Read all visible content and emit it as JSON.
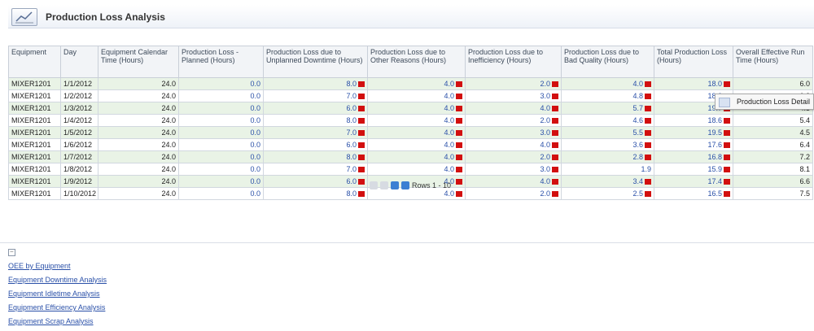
{
  "header": {
    "title": "Production Loss Analysis",
    "icon": "chart-report-icon"
  },
  "table": {
    "columns": [
      "Equipment",
      "Day",
      "Equipment Calendar Time (Hours)",
      "Production Loss - Planned (Hours)",
      "Production Loss due to Unplanned Downtime (Hours)",
      "Production Loss due to Other Reasons (Hours)",
      "Production Loss due to Inefficiency (Hours)",
      "Production Loss due to Bad Quality (Hours)",
      "Total Production Loss (Hours)",
      "Overall Effective Run Time (Hours)"
    ],
    "rows": [
      [
        "MIXER1201",
        "1/1/2012",
        "24.0",
        "0.0",
        "8.0",
        "4.0",
        "2.0",
        "4.0",
        "18.0",
        "6.0"
      ],
      [
        "MIXER1201",
        "1/2/2012",
        "24.0",
        "0.0",
        "7.0",
        "4.0",
        "3.0",
        "4.8",
        "18.0",
        "6.2"
      ],
      [
        "MIXER1201",
        "1/3/2012",
        "24.0",
        "0.0",
        "6.0",
        "4.0",
        "4.0",
        "5.7",
        "19.7",
        "4.3"
      ],
      [
        "MIXER1201",
        "1/4/2012",
        "24.0",
        "0.0",
        "8.0",
        "4.0",
        "2.0",
        "4.6",
        "18.6",
        "5.4"
      ],
      [
        "MIXER1201",
        "1/5/2012",
        "24.0",
        "0.0",
        "7.0",
        "4.0",
        "3.0",
        "5.5",
        "19.5",
        "4.5"
      ],
      [
        "MIXER1201",
        "1/6/2012",
        "24.0",
        "0.0",
        "6.0",
        "4.0",
        "4.0",
        "3.6",
        "17.6",
        "6.4"
      ],
      [
        "MIXER1201",
        "1/7/2012",
        "24.0",
        "0.0",
        "8.0",
        "4.0",
        "2.0",
        "2.8",
        "16.8",
        "7.2"
      ],
      [
        "MIXER1201",
        "1/8/2012",
        "24.0",
        "0.0",
        "7.0",
        "4.0",
        "3.0",
        "1.9",
        "15.9",
        "8.1"
      ],
      [
        "MIXER1201",
        "1/9/2012",
        "24.0",
        "0.0",
        "6.0",
        "4.0",
        "4.0",
        "3.4",
        "17.4",
        "6.6"
      ],
      [
        "MIXER1201",
        "1/10/2012",
        "24.0",
        "0.0",
        "8.0",
        "4.0",
        "2.0",
        "2.5",
        "16.5",
        "7.5"
      ]
    ],
    "flagged_columns": [
      4,
      5,
      6,
      7,
      8
    ],
    "rows_label": "Rows 1 - 10"
  },
  "popup": {
    "label": "Production Loss Detail"
  },
  "related_links": [
    "OEE by Equipment",
    "Equipment Downtime Analysis",
    "Equipment Idletime Analysis",
    "Equipment Efficiency Analysis",
    "Equipment Scrap Analysis"
  ],
  "colors": {
    "link": "#2a50a8",
    "flag": "#d20f0f",
    "row_alt": "#e9f3e6"
  }
}
